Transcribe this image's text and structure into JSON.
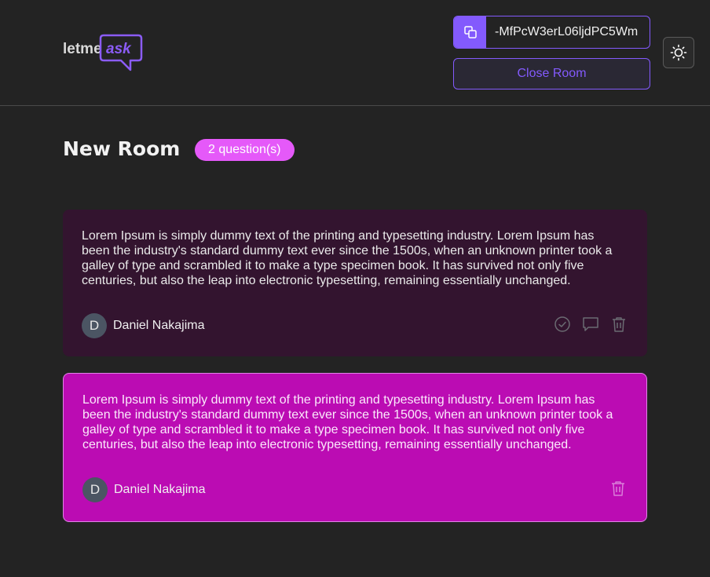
{
  "header": {
    "logo": {
      "text_primary": "letme",
      "text_accent": "ask"
    },
    "room_code": {
      "value": "-MfPcW3erL06ljdPC5Wm",
      "icon": "copy-icon"
    },
    "close_room_label": "Close Room",
    "theme_toggle_icon": "sun-icon"
  },
  "room": {
    "title": "New Room",
    "question_count_label": "2 question(s)"
  },
  "questions": [
    {
      "text": "Lorem Ipsum is simply dummy text of the printing and typesetting industry. Lorem Ipsum has been the industry's standard dummy text ever since the 1500s, when an unknown printer took a galley of type and scrambled it to make a type specimen book. It has survived not only five centuries, but also the leap into electronic typesetting, remaining essentially unchanged.",
      "author": {
        "initial": "D",
        "name": "Daniel Nakajima"
      },
      "actions": [
        "check-circle-icon",
        "chat-bubble-icon",
        "trash-icon"
      ]
    },
    {
      "text": "Lorem Ipsum is simply dummy text of the printing and typesetting industry. Lorem Ipsum has been the industry's standard dummy text ever since the 1500s, when an unknown printer took a galley of type and scrambled it to make a type specimen book. It has survived not only five centuries, but also the leap into electronic typesetting, remaining essentially unchanged.",
      "author": {
        "initial": "D",
        "name": "Daniel Nakajima"
      },
      "actions": [
        "trash-icon"
      ]
    }
  ],
  "colors": {
    "background": "#232323",
    "accent": "#835afd",
    "badge": "#e559f9",
    "question_default": "#33142f",
    "question_highlighted": "#bb0cb3"
  }
}
